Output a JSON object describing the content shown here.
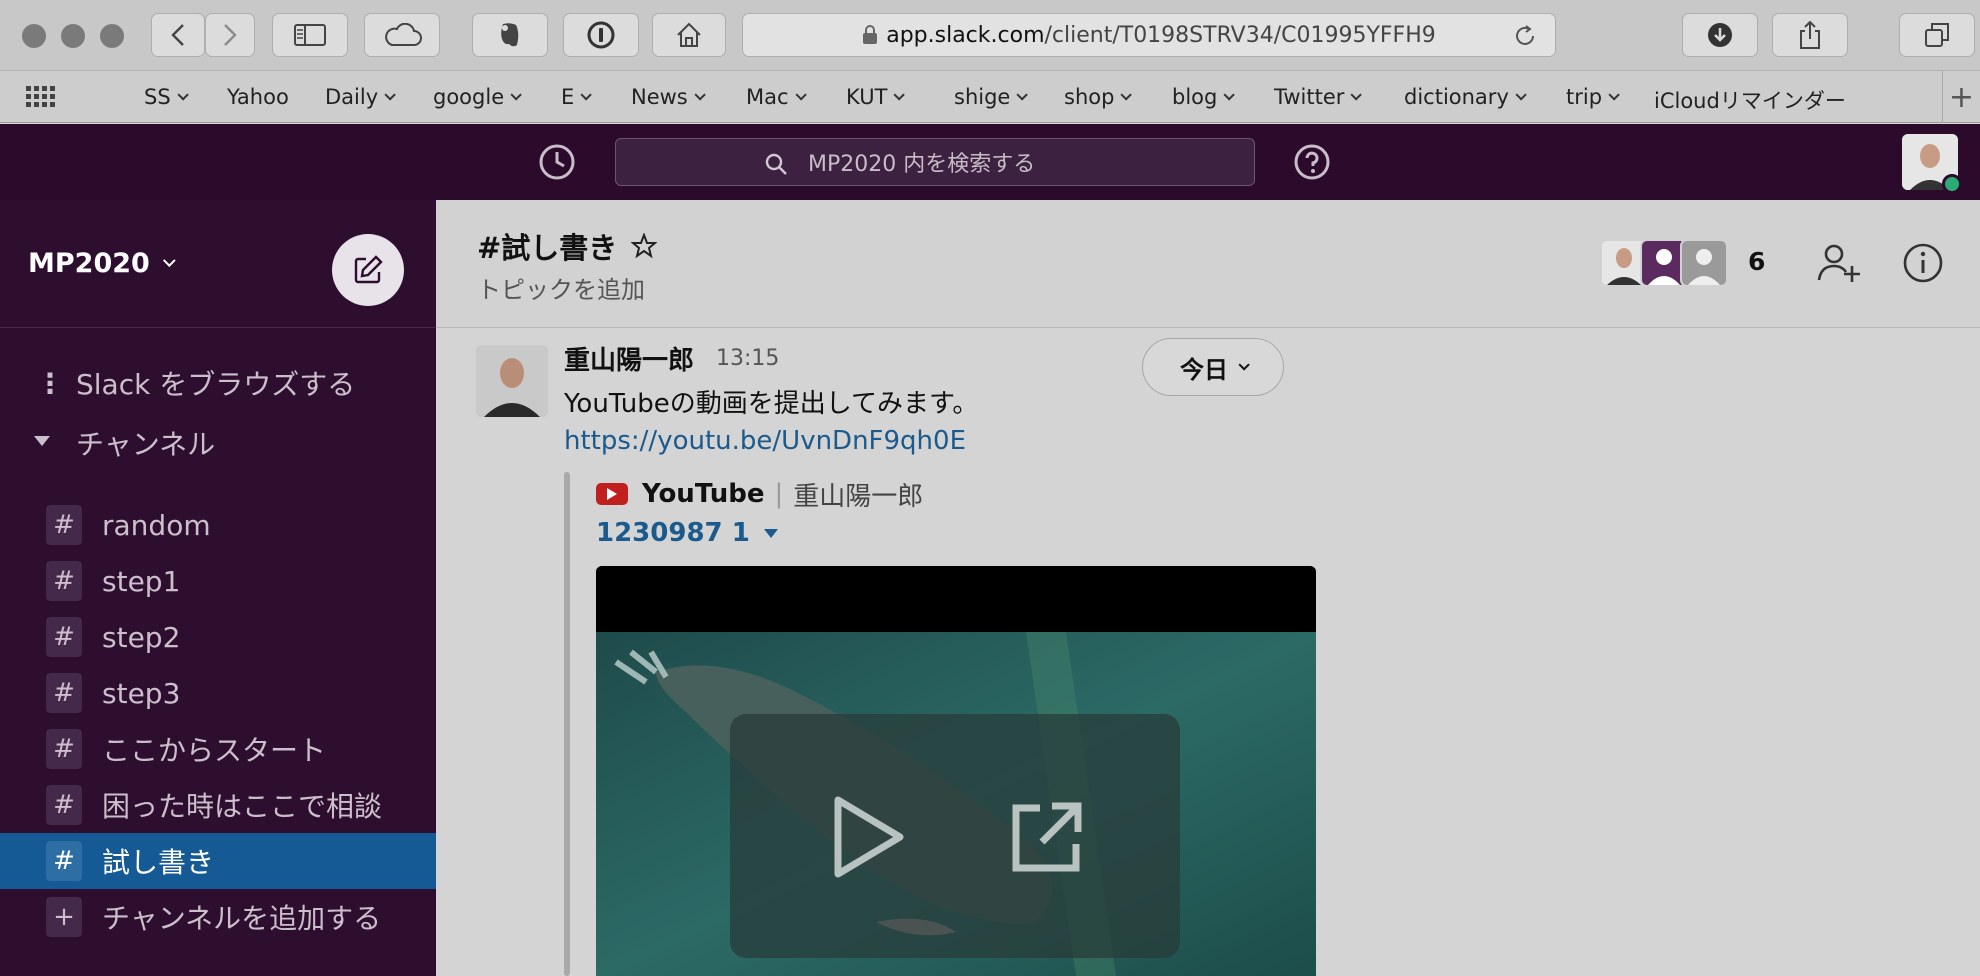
{
  "browser": {
    "url_host": "app.slack.com",
    "url_path": "/client/T0198STRV34/C01995YFFH9",
    "bookmarks": [
      {
        "label": "SS",
        "dropdown": true
      },
      {
        "label": "Yahoo",
        "dropdown": false
      },
      {
        "label": "Daily",
        "dropdown": true
      },
      {
        "label": "google",
        "dropdown": true
      },
      {
        "label": "E",
        "dropdown": true
      },
      {
        "label": "News",
        "dropdown": true
      },
      {
        "label": "Mac",
        "dropdown": true
      },
      {
        "label": "KUT",
        "dropdown": true
      },
      {
        "label": "shige",
        "dropdown": true
      },
      {
        "label": "shop",
        "dropdown": true
      },
      {
        "label": "blog",
        "dropdown": true
      },
      {
        "label": "Twitter",
        "dropdown": true
      },
      {
        "label": "dictionary",
        "dropdown": true
      },
      {
        "label": "trip",
        "dropdown": true
      },
      {
        "label": "iCloudリマインダー",
        "dropdown": false
      }
    ]
  },
  "slack": {
    "search_placeholder": "MP2020 内を検索する",
    "workspace_name": "MP2020",
    "sidebar": {
      "browse_label": "Slack をブラウズする",
      "channels_header": "チャンネル",
      "channels": [
        {
          "name": "random",
          "active": false
        },
        {
          "name": "step1",
          "active": false
        },
        {
          "name": "step2",
          "active": false
        },
        {
          "name": "step3",
          "active": false
        },
        {
          "name": "ここからスタート",
          "active": false
        },
        {
          "name": "困った時はここで相談",
          "active": false
        },
        {
          "name": "試し書き",
          "active": true
        }
      ],
      "add_channel_label": "チャンネルを追加する"
    },
    "channel": {
      "title": "#試し書き",
      "topic": "トピックを追加",
      "member_count": "6"
    },
    "message": {
      "author": "重山陽一郎",
      "time": "13:15",
      "text": "YouTubeの動画を提出してみます。",
      "link": "https://youtu.be/UvnDnF9qh0E",
      "date_divider": "今日",
      "attachment": {
        "service": "YouTube",
        "author": "重山陽一郎",
        "title": "1230987 1"
      }
    },
    "colors": {
      "sidebar_bg": "#2e0e2f",
      "topbar_bg": "#2b0a2c",
      "active_channel": "#155a94",
      "link": "#1a5a8d"
    }
  }
}
